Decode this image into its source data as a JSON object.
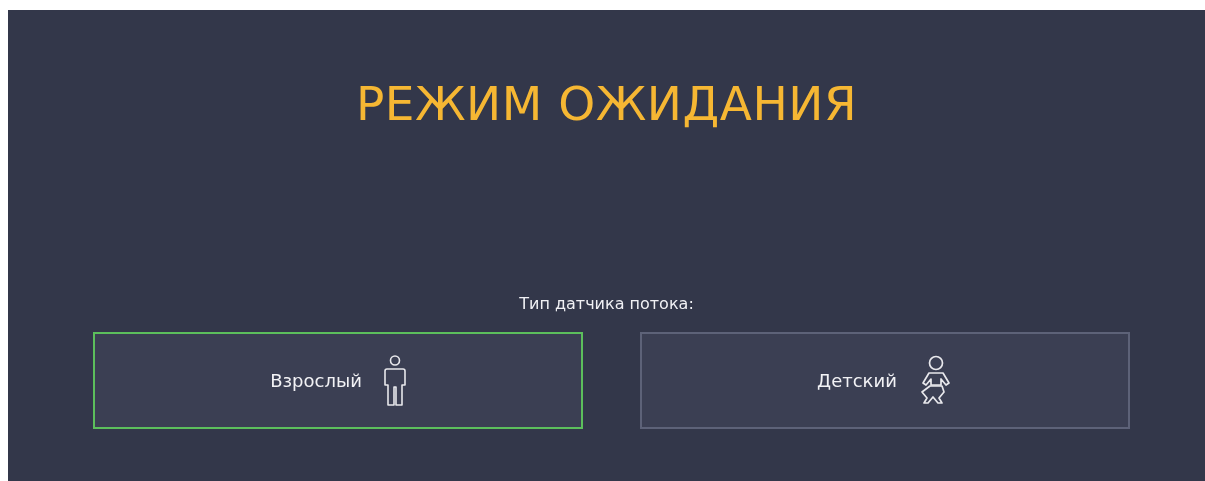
{
  "title": "РЕЖИМ ОЖИДАНИЯ",
  "sensor_label": "Тип датчика потока:",
  "options": [
    {
      "label": "Взрослый",
      "kind": "adult",
      "selected": true
    },
    {
      "label": "Детский",
      "kind": "child",
      "selected": false
    }
  ]
}
